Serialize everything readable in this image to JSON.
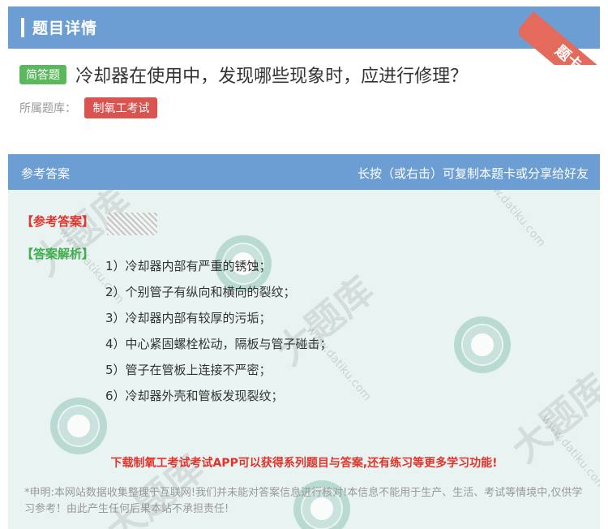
{
  "header": {
    "title": "题目详情",
    "corner_badge": "题卡"
  },
  "question": {
    "type_badge": "简答题",
    "title": "冷却器在使用中，发现哪些现象时，应进行修理？",
    "bank_label": "所属题库：",
    "bank_tag": "制氧工考试"
  },
  "answer_panel": {
    "header_left": "参考答案",
    "header_right": "长按（或右击）可复制本题卡或分享给好友",
    "ref_answer_tag": "【参考答案】",
    "analysis_tag": "【答案解析】",
    "steps": [
      "1）冷却器内部有严重的锈蚀；",
      "2）个别管子有纵向和横向的裂纹；",
      "3）冷却器内部有较厚的污垢；",
      "4）中心紧固螺栓松动，隔板与管子碰击；",
      "5）管子在管板上连接不严密；",
      "6）冷却器外壳和管板发现裂纹；"
    ],
    "promo": "下载制氧工考试考试APP可以获得系列题目与答案,还有练习等更多学习功能!",
    "disclaimer": "*申明:本网站数据收集整理于互联网!我们并未能对答案信息进行核对!本信息不能用于生产、生活、考试等情境中,仅供学习参考！由此产生任何后果本站不承担责任!"
  },
  "watermark": {
    "text": "大题库",
    "url": "www.datiku.com"
  },
  "colors": {
    "header": "#6d9ed3",
    "type_badge": "#5cb85c",
    "bank_tag": "#d9534f",
    "promo": "#e0342c",
    "panel_bg": "#e9f4f2"
  }
}
